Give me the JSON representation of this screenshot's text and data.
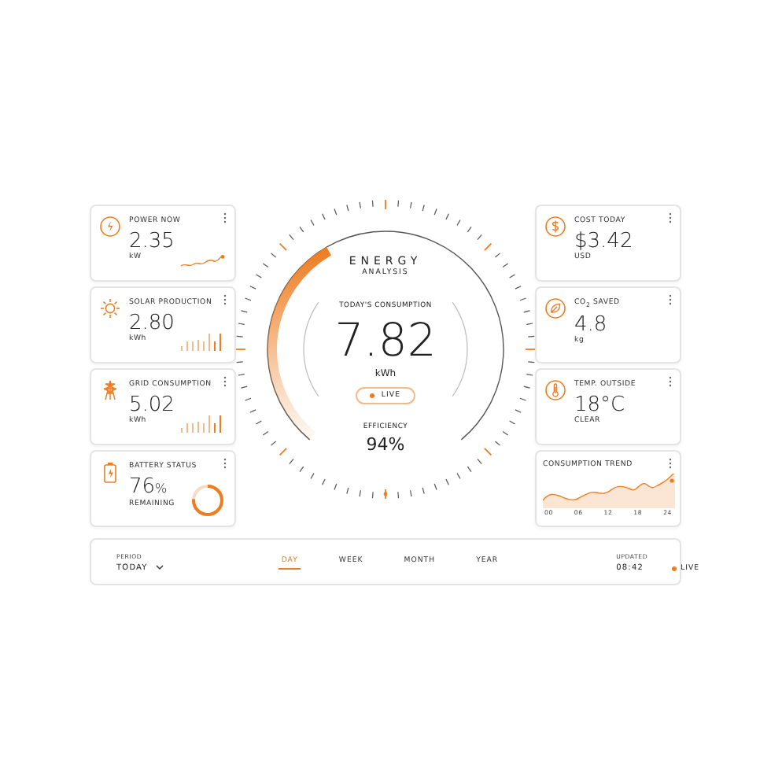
{
  "left_cards": [
    {
      "title": "POWER NOW",
      "value": "2.35",
      "unit": "kW",
      "kind": "sparkline"
    },
    {
      "title": "SOLAR PRODUCTION",
      "value": "2.80",
      "unit": "kWh",
      "kind": "bars"
    },
    {
      "title": "GRID CONSUMPTION",
      "value": "5.02",
      "unit": "kWh",
      "kind": "bars"
    },
    {
      "title": "BATTERY STATUS",
      "value": "76",
      "suffix": "%",
      "unit": "REMAINING",
      "kind": "ring"
    }
  ],
  "gauge": {
    "title": "ENERGY",
    "subtitle": "ANALYSIS",
    "label": "TODAY'S CONSUMPTION",
    "value": "7.82",
    "unit": "kWh",
    "badge": "LIVE",
    "efficiency_label": "EFFICIENCY",
    "efficiency": "94%"
  },
  "right_cards": [
    {
      "title": "COST TODAY",
      "value": "$3.42",
      "unit": "USD"
    },
    {
      "title": "CO$_{2}$ SAVED",
      "value": "4.8",
      "unit": "kg"
    },
    {
      "title": "TEMP. OUTSIDE",
      "value": "18°C",
      "unit": "CLEAR"
    }
  ],
  "trend": {
    "title": "CONSUMPTION TREND",
    "x_labels": [
      "00",
      "06",
      "12",
      "18",
      "24"
    ]
  },
  "footer": {
    "period_label": "PERIOD",
    "period": "TODAY",
    "tabs": [
      {
        "label": "DAY",
        "selected": true
      },
      {
        "label": "WEEK",
        "selected": false
      },
      {
        "label": "MONTH",
        "selected": false
      },
      {
        "label": "YEAR",
        "selected": false
      }
    ],
    "updated_label": "UPDATED",
    "updated": "08:42",
    "live": "LIVE"
  }
}
